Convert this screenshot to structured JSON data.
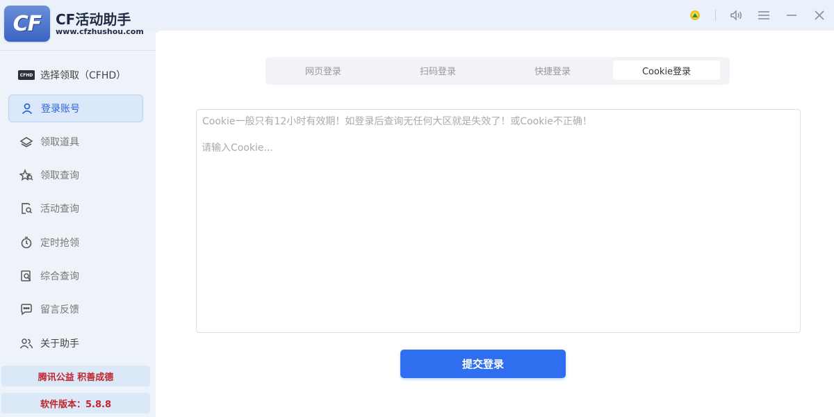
{
  "app": {
    "logo_text": "CF",
    "title": "CF活动助手",
    "url": "www.cfzhushou.com"
  },
  "window_controls": [
    "coin-icon",
    "volume-icon",
    "menu-icon",
    "minimize-icon",
    "close-icon"
  ],
  "sidebar": {
    "items": [
      {
        "label": "选择领取（CFHD）",
        "icon": "cfhd-badge-icon",
        "active": false
      },
      {
        "label": "登录账号",
        "icon": "user-icon",
        "active": true
      },
      {
        "label": "领取道具",
        "icon": "layers-icon",
        "active": false
      },
      {
        "label": "领取查询",
        "icon": "star-search-icon",
        "active": false
      },
      {
        "label": "活动查询",
        "icon": "doc-search-icon",
        "active": false
      },
      {
        "label": "定时抢领",
        "icon": "timer-icon",
        "active": false
      },
      {
        "label": "综合查询",
        "icon": "file-search-icon",
        "active": false
      },
      {
        "label": "留言反馈",
        "icon": "chat-icon",
        "active": false
      },
      {
        "label": "关于助手",
        "icon": "users-icon",
        "active": false
      }
    ],
    "cfhd_badge_text": "CFHD",
    "promo": "腾讯公益 积善成德",
    "version": "软件版本：5.8.8"
  },
  "main": {
    "tabs": [
      {
        "label": "网页登录",
        "active": false
      },
      {
        "label": "扫码登录",
        "active": false
      },
      {
        "label": "快捷登录",
        "active": false
      },
      {
        "label": "Cookie登录",
        "active": true
      }
    ],
    "cookie_hint": "Cookie一般只有12小时有效期！如登录后查询无任何大区就是失效了！或Cookie不正确！",
    "cookie_placeholder": "请输入Cookie...",
    "cookie_value": "",
    "submit_label": "提交登录"
  },
  "colors": {
    "accent": "#2f6fef",
    "active_nav_bg": "#dbe8fa",
    "promo_text": "#c0252d",
    "sidebar_bg": "#eef3fa"
  }
}
